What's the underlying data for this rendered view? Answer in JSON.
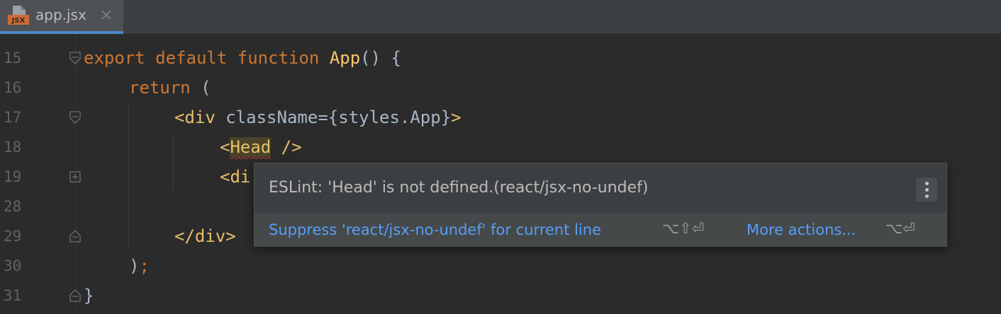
{
  "tab": {
    "filename": "app.jsx",
    "icon": "jsx-file-icon",
    "badge": "JSX"
  },
  "lines": [
    {
      "num": "15",
      "fold": "open"
    },
    {
      "num": "16",
      "fold": "none"
    },
    {
      "num": "17",
      "fold": "open"
    },
    {
      "num": "18",
      "fold": "none"
    },
    {
      "num": "19",
      "fold": "collapsed"
    },
    {
      "num": "28",
      "fold": "none"
    },
    {
      "num": "29",
      "fold": "close"
    },
    {
      "num": "30",
      "fold": "none"
    },
    {
      "num": "31",
      "fold": "close"
    }
  ],
  "code": {
    "l15": {
      "k1": "export",
      "k2": "default",
      "k3": "function",
      "name": "App",
      "rest": "() {"
    },
    "l16": {
      "k": "return",
      "rest": " ("
    },
    "l17": {
      "open": "<",
      "tag": "div",
      "attr": " className",
      "eq": "=",
      "val": "{styles.App}",
      "close": ">"
    },
    "l18": {
      "open": "<",
      "tag": "Head",
      "close": " />"
    },
    "l19": {
      "open": "<",
      "tag": "di"
    },
    "l29": {
      "open": "</",
      "tag": "div",
      "close": ">"
    },
    "l30": {
      "paren": ")",
      "semi": ";"
    },
    "l31": {
      "brace": "}"
    }
  },
  "popup": {
    "message": "ESLint: 'Head' is not defined.(react/jsx-no-undef)",
    "suppress": "Suppress 'react/jsx-no-undef' for current line",
    "suppress_keys": "⌥⇧⏎",
    "more": "More actions...",
    "more_keys": "⌥⏎"
  },
  "colors": {
    "accent": "#4a88c7",
    "link": "#589df6",
    "keyword": "#cc7832",
    "function": "#ffc66d",
    "error": "#bc3f3c"
  }
}
